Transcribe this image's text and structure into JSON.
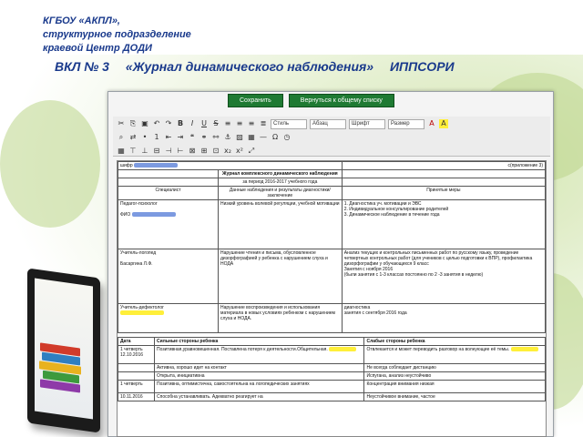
{
  "header": {
    "line1": "КГБОУ «АКПЛ»,",
    "line2": "структурное подразделение",
    "line3": "краевой Центр ДОДИ",
    "title_left": "ВКЛ № 3",
    "title_center": "«Журнал динамического наблюдения»",
    "title_right": "ИППСОРИ"
  },
  "toolbar": {
    "save_label": "Сохранить",
    "back_label": "Вернуться к общему списку",
    "style_select": "Стиль",
    "format_select": "Абзац",
    "font_select": "Шрифт",
    "size_select": "Размер"
  },
  "doc": {
    "cipher": "шифр",
    "appendix": "с(приложение 3)",
    "journal_title": "Журнал комплексного динамического наблюдения",
    "period": "за период 2016-2017 учебного года",
    "col1": "Специалист",
    "col2": "Данные наблюдения и результаты диагностики/заключение",
    "col3": "Принятые меры",
    "r1_spec": "Педагог-психолог",
    "r1_fio": "ФИО",
    "r1_data": "Низкий уровень волевой регуляции, учебной мотивации",
    "r1_measures": "1. Диагностика уч. мотивации и ЭВС\n2. Индивидуальное консультирование родителей\n3. Динамическое наблюдение в течение года",
    "r2_spec": "Учитель-логопед",
    "r2_fio": "Басаргина Л.Ф.",
    "r2_data": "Нарушение чтения и письма, обусловленное дизорфографией у ребенка с нарушением слуха и НОДА",
    "r2_measures": "Анализ текущих и контрольных письменных работ по русскому языку, проведение четвертных контрольных работ (для учеников с целью подготовки к ВПР), профилактика дизорфографии у обучающихся 9 класс\nЗанятия с ноября 2016\n(были занятия с 1-3 классах постоянно по 2 -3 занятия в неделю)",
    "r3_spec": "Учитель-дефектолог",
    "r3_data": "Нарушение воспроизведения и использования материала в новых условиях ребенком с нарушением слуха и НОДА.",
    "r3_measures": "диагностика\nзанятия с сентября 2016 года",
    "t2_date": "Дата",
    "t2_strong": "Сильные стороны ребенка",
    "t2_weak": "Слабые стороны ребенка",
    "t2_r1_date": "1 четверть 12.10.2016",
    "t2_r1_strong": "Позитивная,уравновешенная. Поставлена потеря к деятельности.Общительная.",
    "t2_r1_weak": "Отвлекается и может переводить разговор на волнующие её темы.",
    "t2_r2_strong": "Активна, хорошо идет на контакт",
    "t2_r2_weak": "Не всегда соблюдает дистанцию",
    "t2_r3_strong": "Открыта, инициативна",
    "t2_r3_weak": "Испугана, анализ неустойчиво",
    "t2_r4_date": "1 четверть",
    "t2_r4_strong": "Позитивна, оптимистична, самостоятельна на логопедических занятиях",
    "t2_r4_weak": "Концентрация внимания низкая",
    "t2_r5_date": "10.11.2016",
    "t2_r5_strong": "Способна устанавливать. Адекватно реагирует на",
    "t2_r5_weak": "Неустойчивое внимание, частое"
  },
  "colors": {
    "title_blue": "#1a3a8c",
    "save_green": "#1f7a33",
    "highlight_blue": "#6f8dd8",
    "highlight_yellow": "#ffef3a"
  }
}
